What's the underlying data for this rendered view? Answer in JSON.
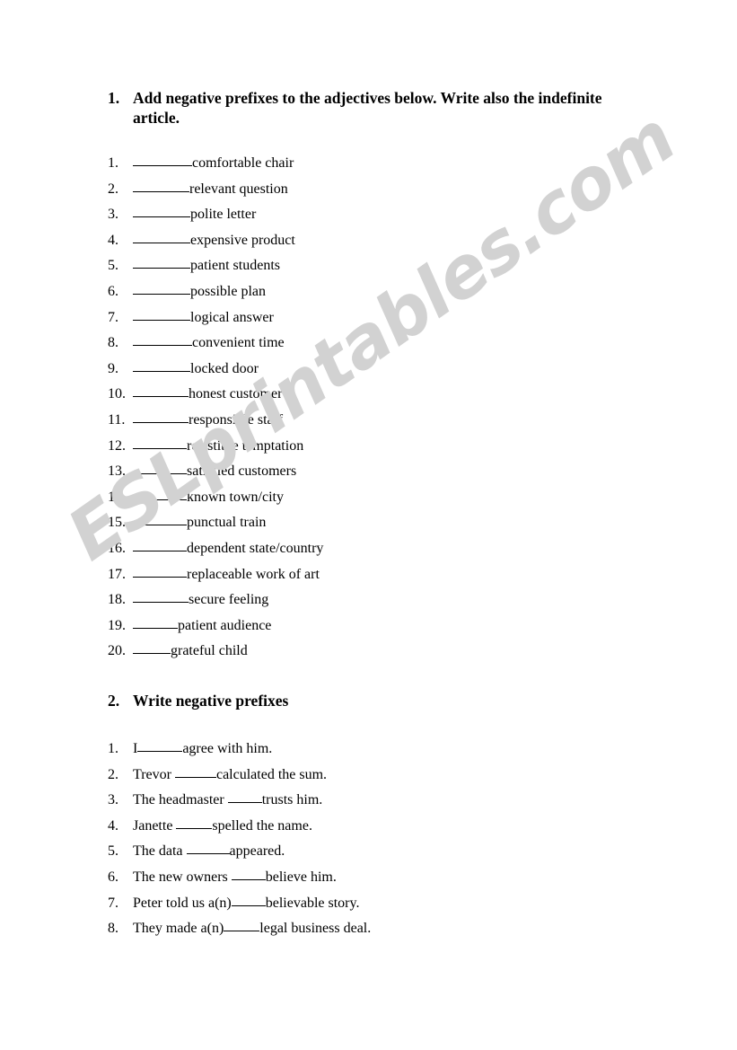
{
  "watermark": {
    "text": "ESLprintables.com",
    "color": "#d2d2d2"
  },
  "sections": [
    {
      "number": "1.",
      "heading": "Add negative prefixes to the adjectives below. Write also the indefinite article.",
      "items": [
        {
          "number": "1.",
          "pre": "",
          "blank_width": 66,
          "post": "comfortable chair"
        },
        {
          "number": "2.",
          "pre": "",
          "blank_width": 63,
          "post": "relevant question"
        },
        {
          "number": "3.",
          "pre": "",
          "blank_width": 64,
          "post": "polite letter"
        },
        {
          "number": "4.",
          "pre": "",
          "blank_width": 64,
          "post": "expensive product"
        },
        {
          "number": "5.",
          "pre": "",
          "blank_width": 64,
          "post": "patient students"
        },
        {
          "number": "6.",
          "pre": "",
          "blank_width": 64,
          "post": "possible plan"
        },
        {
          "number": "7.",
          "pre": "",
          "blank_width": 64,
          "post": "logical answer"
        },
        {
          "number": "8.",
          "pre": "",
          "blank_width": 66,
          "post": "convenient time"
        },
        {
          "number": "9.",
          "pre": "",
          "blank_width": 64,
          "post": "locked door"
        },
        {
          "number": "10.",
          "pre": "",
          "blank_width": 62,
          "post": "honest customer"
        },
        {
          "number": "11.",
          "pre": "",
          "blank_width": 62,
          "post": "responsible staff"
        },
        {
          "number": "12.",
          "pre": "",
          "blank_width": 60,
          "post": "resistible temptation"
        },
        {
          "number": "13.",
          "pre": "",
          "blank_width": 60,
          "post": "satisfied customers"
        },
        {
          "number": "14.",
          "pre": "",
          "blank_width": 60,
          "post": "known town/city"
        },
        {
          "number": "15.",
          "pre": "",
          "blank_width": 60,
          "post": "punctual train"
        },
        {
          "number": "16.",
          "pre": "",
          "blank_width": 60,
          "post": "dependent state/country"
        },
        {
          "number": "17.",
          "pre": "",
          "blank_width": 60,
          "post": "replaceable work of art"
        },
        {
          "number": "18.",
          "pre": "",
          "blank_width": 62,
          "post": "secure feeling"
        },
        {
          "number": "19.",
          "pre": "",
          "blank_width": 50,
          "post": "patient audience"
        },
        {
          "number": "20.",
          "pre": "",
          "blank_width": 42,
          "post": "grateful child"
        }
      ]
    },
    {
      "number": "2.",
      "heading": "Write negative prefixes",
      "items": [
        {
          "number": "1.",
          "pre": "I",
          "blank_width": 50,
          "post": "agree with him."
        },
        {
          "number": "2.",
          "pre": "Trevor ",
          "blank_width": 46,
          "post": "calculated the sum."
        },
        {
          "number": "3.",
          "pre": "The headmaster ",
          "blank_width": 38,
          "post": "trusts him."
        },
        {
          "number": "4.",
          "pre": "Janette ",
          "blank_width": 40,
          "post": "spelled the name."
        },
        {
          "number": "5.",
          "pre": "The data ",
          "blank_width": 48,
          "post": "appeared."
        },
        {
          "number": "6.",
          "pre": "The new owners ",
          "blank_width": 38,
          "post": "believe him."
        },
        {
          "number": "7.",
          "pre": "Peter told us a(n)",
          "blank_width": 38,
          "post": "believable story."
        },
        {
          "number": "8.",
          "pre": "They made a(n)",
          "blank_width": 40,
          "post": "legal business deal."
        }
      ]
    }
  ]
}
